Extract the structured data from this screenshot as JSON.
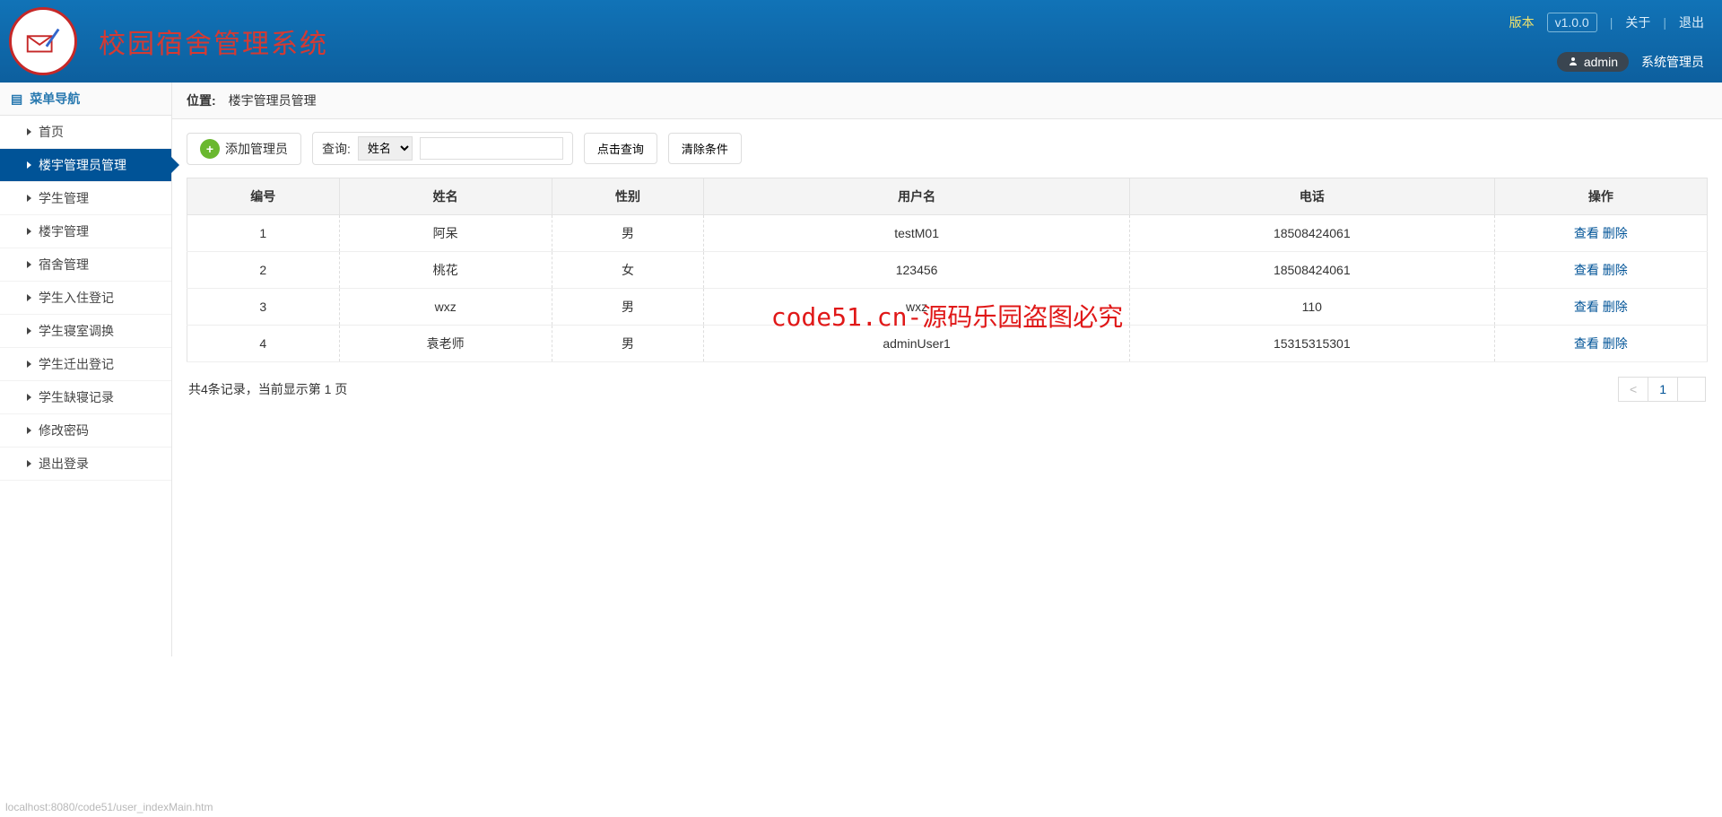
{
  "header": {
    "app_title": "校园宿舍管理系统",
    "version_label": "版本",
    "version": "v1.0.0",
    "about": "关于",
    "logout": "退出",
    "username": "admin",
    "role": "系统管理员"
  },
  "sidebar": {
    "title": "菜单导航",
    "items": [
      {
        "label": "首页"
      },
      {
        "label": "楼宇管理员管理"
      },
      {
        "label": "学生管理"
      },
      {
        "label": "楼宇管理"
      },
      {
        "label": "宿舍管理"
      },
      {
        "label": "学生入住登记"
      },
      {
        "label": "学生寝室调换"
      },
      {
        "label": "学生迁出登记"
      },
      {
        "label": "学生缺寝记录"
      },
      {
        "label": "修改密码"
      },
      {
        "label": "退出登录"
      }
    ],
    "active_index": 1
  },
  "breadcrumb": {
    "label": "位置:",
    "current": "楼宇管理员管理"
  },
  "toolbar": {
    "add_label": "添加管理员",
    "search_label": "查询:",
    "search_field_selected": "姓名",
    "search_value": "",
    "search_btn": "点击查询",
    "clear_btn": "清除条件"
  },
  "table": {
    "headers": [
      "编号",
      "姓名",
      "性别",
      "用户名",
      "电话",
      "操作"
    ],
    "rows": [
      {
        "id": "1",
        "name": "阿呆",
        "gender": "男",
        "username": "testM01",
        "phone": "18508424061"
      },
      {
        "id": "2",
        "name": "桃花",
        "gender": "女",
        "username": "123456",
        "phone": "18508424061"
      },
      {
        "id": "3",
        "name": "wxz",
        "gender": "男",
        "username": "wxz",
        "phone": "110"
      },
      {
        "id": "4",
        "name": "袁老师",
        "gender": "男",
        "username": "adminUser1",
        "phone": "15315315301"
      }
    ],
    "op_view": "查看",
    "op_delete": "删除"
  },
  "footer": {
    "summary": "共4条记录，当前显示第 1 页",
    "prev": "<",
    "current_page": "1"
  },
  "watermark": "code51.cn-源码乐园盗图必究",
  "status_url": "localhost:8080/code51/user_indexMain.htm"
}
